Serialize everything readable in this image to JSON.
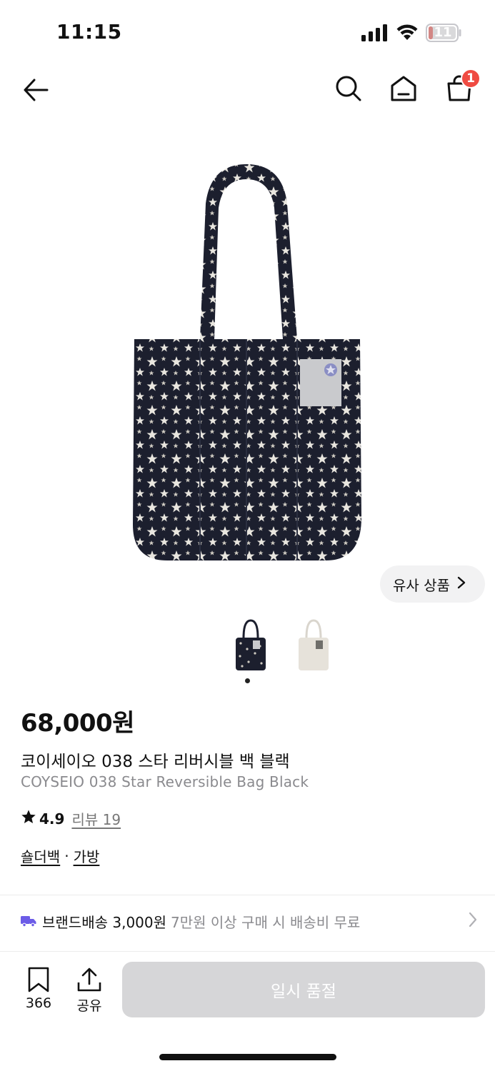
{
  "status_bar": {
    "time": "11:15",
    "battery_level": "11",
    "signal_icon": "signal-bars-icon",
    "wifi_icon": "wifi-icon",
    "battery_icon": "battery-low-icon"
  },
  "nav": {
    "back_icon": "arrow-left-icon",
    "search_icon": "search-icon",
    "home_icon": "home-icon",
    "cart_icon": "shopping-bag-icon",
    "cart_badge": "1"
  },
  "product": {
    "similar_label": "유사 상품",
    "price": "68,000원",
    "name_ko": "코이세이오 038 스타 리버시블 백 블랙",
    "name_en": "COYSEIO 038 Star Reversible Bag Black",
    "rating": "4.9",
    "review_label": "리뷰 19",
    "category_1": "숄더백",
    "category_sep": "·",
    "category_2": "가방",
    "thumbnail_count": 2,
    "selected_thumbnail": 1
  },
  "shipping": {
    "label": "브랜드배송 3,000원",
    "note": "7만원 이상 구매 시 배송비 무료"
  },
  "bottom_bar": {
    "bookmark_count": "366",
    "share_label": "공유",
    "soldout_label": "일시 품절"
  },
  "colors": {
    "badge_red": "#ef4b42",
    "truck_purple": "#6c5ce7",
    "disabled_button": "#d6d6d8",
    "bag_navy": "#1c1f2e"
  }
}
